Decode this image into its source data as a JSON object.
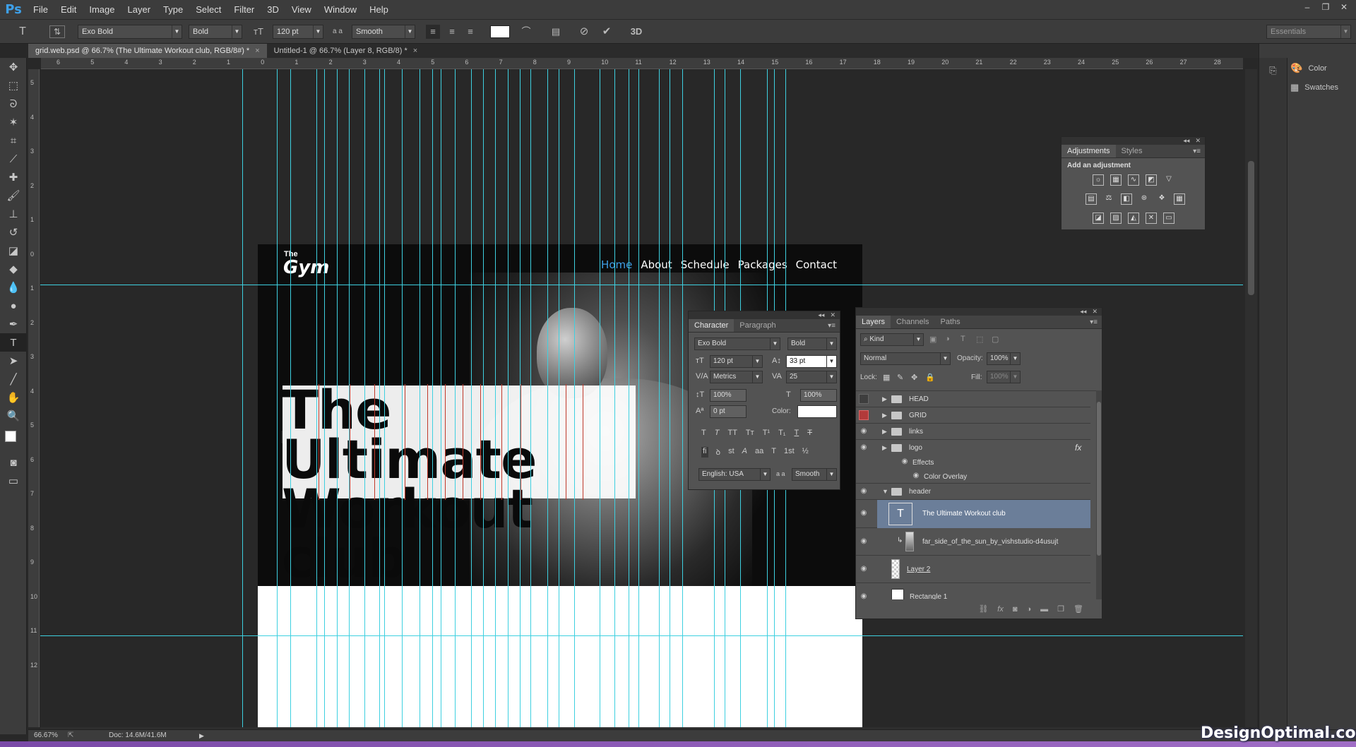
{
  "app": {
    "logo": "Ps"
  },
  "menu": [
    "File",
    "Edit",
    "Image",
    "Layer",
    "Type",
    "Select",
    "Filter",
    "3D",
    "View",
    "Window",
    "Help"
  ],
  "window_controls": [
    "–",
    "❐",
    "✕"
  ],
  "options": {
    "tool_glyph": "T",
    "font_family": "Exo Bold",
    "font_style": "Bold",
    "font_size": "120 pt",
    "aa_label": "a a",
    "antialias": "Smooth",
    "mode_3d": "3D",
    "workspace": "Essentials"
  },
  "tabs": [
    {
      "label": "grid.web.psd @ 66.7% (The Ultimate Workout club, RGB/8#) *",
      "close": "×"
    },
    {
      "label": "Untitled-1 @ 66.7% (Layer 8, RGB/8) *",
      "close": "×"
    }
  ],
  "ruler_h": [
    "6",
    "5",
    "4",
    "3",
    "2",
    "1",
    "0",
    "1",
    "2",
    "3",
    "4",
    "5",
    "6",
    "7",
    "8",
    "9",
    "10",
    "11",
    "12",
    "13",
    "14",
    "15",
    "16",
    "17",
    "18",
    "19",
    "20",
    "21",
    "22",
    "23",
    "24",
    "25",
    "26",
    "27",
    "28"
  ],
  "ruler_v": [
    "5",
    "4",
    "3",
    "2",
    "1",
    "0",
    "1",
    "2",
    "3",
    "4",
    "5",
    "6",
    "7",
    "8",
    "9",
    "10",
    "11",
    "12"
  ],
  "artboard": {
    "brand_small": "The",
    "brand": "Gym",
    "nav": [
      "Home",
      "About",
      "Schedule",
      "Packages",
      "Contact"
    ],
    "headline_1": "The Ultimate",
    "headline_2": "Workout club"
  },
  "character_panel": {
    "tabs": [
      "Character",
      "Paragraph"
    ],
    "font_family": "Exo Bold",
    "font_style": "Bold",
    "size": "120 pt",
    "leading": "33 pt",
    "kerning": "Metrics",
    "tracking": "25",
    "vscale": "100%",
    "hscale": "100%",
    "baseline": "0 pt",
    "color_label": "Color:",
    "style_buttons": [
      "T",
      "T",
      "TT",
      "Tт",
      "T¹",
      "T₁",
      "T",
      "T"
    ],
    "ot_buttons": [
      "fi",
      "ꝺ",
      "st",
      "A",
      "aa",
      "T",
      "1st",
      "½"
    ],
    "language": "English: USA",
    "aa_label": "a a",
    "antialias": "Smooth",
    "color": "#ffffff"
  },
  "layers_panel": {
    "tabs": [
      "Layers",
      "Channels",
      "Paths"
    ],
    "filter": "Kind",
    "blend": "Normal",
    "opacity_label": "Opacity:",
    "opacity": "100%",
    "lock_label": "Lock:",
    "fill_label": "Fill:",
    "fill": "100%",
    "fx": "fx",
    "layers": [
      {
        "name": "HEAD"
      },
      {
        "name": "GRID"
      },
      {
        "name": "links"
      },
      {
        "name": "logo"
      },
      {
        "name": "Effects"
      },
      {
        "name": "Color Overlay"
      },
      {
        "name": "header"
      },
      {
        "name": "The Ultimate Workout club"
      },
      {
        "name": "far_side_of_the_sun_by_vishstudio-d4usujt"
      },
      {
        "name": "Layer 2"
      },
      {
        "name": "Rectangle 1"
      }
    ]
  },
  "adjustments_panel": {
    "tabs": [
      "Adjustments",
      "Styles"
    ],
    "title": "Add an adjustment"
  },
  "right_dock": {
    "items": [
      "Color",
      "Swatches"
    ]
  },
  "status": {
    "zoom": "66.67%",
    "doc": "Doc: 14.6M/41.6M"
  },
  "watermark": "DesignOptimal.com",
  "colors": {
    "guide": "#3ed0e0",
    "accent": "#3ea0e8",
    "selection": "#6b7e99"
  }
}
